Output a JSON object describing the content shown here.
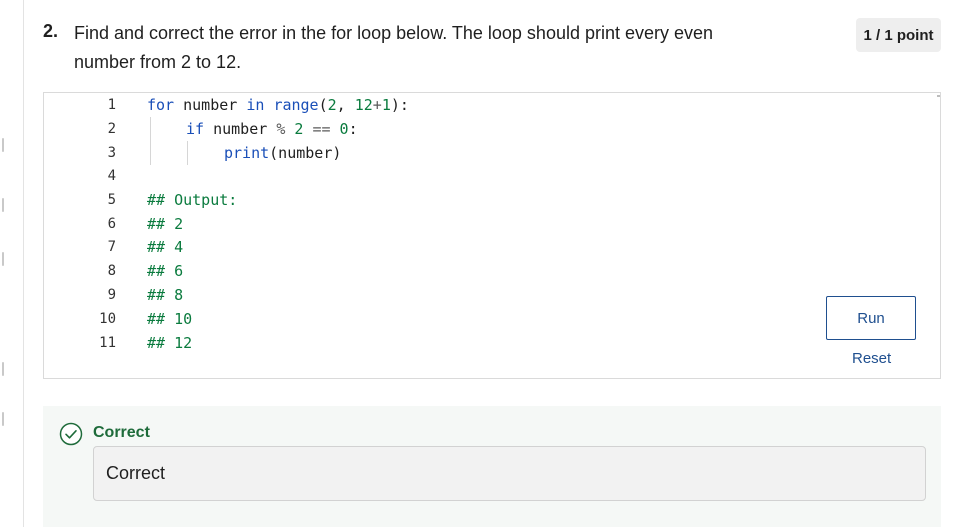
{
  "question": {
    "number": "2.",
    "text": "Find and correct the error in the for loop below.  The loop should print every even number from 2 to 12.",
    "points": "1 / 1 point"
  },
  "editor": {
    "line_numbers": [
      "1",
      "2",
      "3",
      "4",
      "5",
      "6",
      "7",
      "8",
      "9",
      "10",
      "11"
    ],
    "code": {
      "l1": {
        "kw_for": "for",
        "var": " number ",
        "kw_in": "in",
        "sp": " ",
        "fn_range": "range",
        "p1": "(",
        "n2": "2",
        "comma": ", ",
        "n12": "12",
        "plus": "+",
        "n1": "1",
        "p2": "):"
      },
      "l2": {
        "kw_if": "if",
        "var": " number ",
        "op_mod": "%",
        "sp1": " ",
        "n2": "2",
        "sp2": " ",
        "op_eq": "==",
        "sp3": " ",
        "n0": "0",
        "colon": ":"
      },
      "l3": {
        "fn_print": "print",
        "args": "(number)"
      },
      "l5": "## Output:",
      "l6": "## 2",
      "l7": "## 4",
      "l8": "## 6",
      "l9": "## 8",
      "l10": "## 10",
      "l11": "## 12"
    },
    "run_label": "Run",
    "reset_label": "Reset"
  },
  "feedback": {
    "title": "Correct",
    "message": "Correct",
    "icon": "check-circle-icon",
    "accent_color": "#1e6b3a"
  },
  "colors": {
    "keyword": "#1a4fb8",
    "number": "#0a7b3e",
    "comment": "#0a7b3e",
    "button": "#1f4f8f"
  }
}
